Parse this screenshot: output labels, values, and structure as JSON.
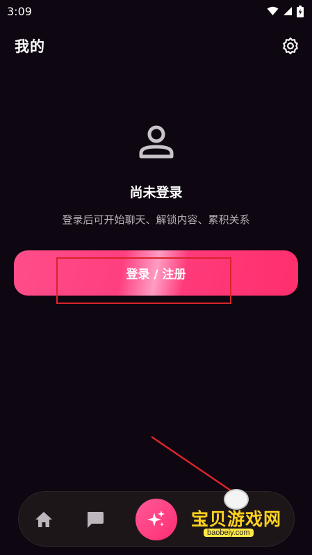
{
  "status_bar": {
    "time": "3:09",
    "icons": [
      "wifi-icon",
      "cell-signal-icon",
      "battery-charging-icon"
    ]
  },
  "header": {
    "title": "我的",
    "settings_icon": "gear-icon"
  },
  "profile": {
    "avatar_icon": "person-icon",
    "status": "尚未登录",
    "hint": "登录后可开始聊天、解锁内容、累积关系"
  },
  "login_button": {
    "label": "登录 / 注册"
  },
  "bottom_nav": {
    "items": [
      {
        "icon": "home-icon"
      },
      {
        "icon": "chat-bubble-icon"
      },
      {
        "icon": "sparkle-icon"
      }
    ]
  },
  "watermark": {
    "text": "宝贝游戏网",
    "url": "baobeiy.com"
  },
  "colors": {
    "background": "#0e0610",
    "accent": "#ff3f7f",
    "annotation": "#d9242c",
    "watermark": "#ffd21f"
  }
}
